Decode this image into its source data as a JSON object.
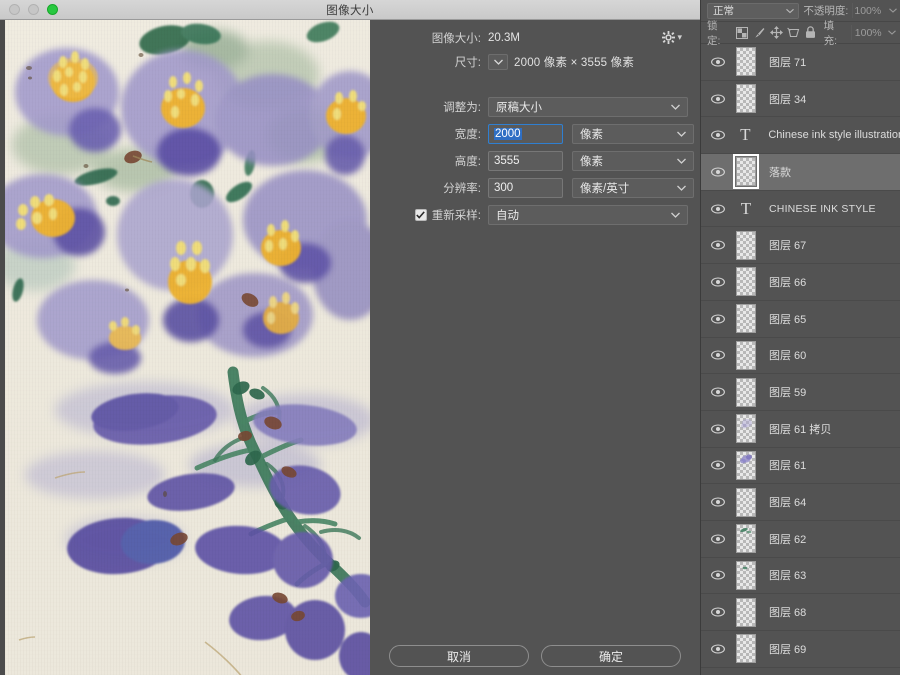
{
  "window": {
    "title": "图像大小",
    "traffic_lights": [
      "close-gray",
      "minimize-gray",
      "zoom-green"
    ]
  },
  "dialog": {
    "image_size_label": "图像大小:",
    "image_size_value": "20.3M",
    "gear_icon": "gear-icon",
    "dimensions_label": "尺寸:",
    "dimensions_value": "2000 像素  ×  3555 像素",
    "fit_to_label": "调整为:",
    "fit_to_value": "原稿大小",
    "width_label": "宽度:",
    "width_value": "2000",
    "width_unit": "像素",
    "height_label": "高度:",
    "height_value": "3555",
    "height_unit": "像素",
    "resolution_label": "分辨率:",
    "resolution_value": "300",
    "resolution_unit": "像素/英寸",
    "resample_label": "重新采样:",
    "resample_value": "自动",
    "resample_checked": true,
    "link_icon": "chain-link-icon",
    "cancel_label": "取消",
    "ok_label": "确定",
    "accent_color": "#2f6fc4",
    "bg_color": "#535353"
  },
  "layers_panel": {
    "blend_mode": "正常",
    "opacity_label": "不透明度:",
    "opacity_value": "100%",
    "lock_label": "锁定:",
    "lock_icons": [
      "transparency-checker-icon",
      "brush-icon",
      "move-arrows-icon",
      "artboard-icon",
      "lock-icon"
    ],
    "fill_label": "填充:",
    "fill_value": "100%",
    "layers": [
      {
        "name": "图层 71",
        "type": "raster",
        "visible": true,
        "selected": false,
        "thumb": "empty"
      },
      {
        "name": "图层 34",
        "type": "raster",
        "visible": true,
        "selected": false,
        "thumb": "empty"
      },
      {
        "name": "Chinese ink style illustration",
        "type": "text",
        "visible": true,
        "selected": false,
        "thumb": "T"
      },
      {
        "name": "落款",
        "type": "raster",
        "visible": true,
        "selected": true,
        "thumb": "empty"
      },
      {
        "name": "CHINESE INK STYLE",
        "type": "text",
        "visible": true,
        "selected": false,
        "thumb": "T"
      },
      {
        "name": "图层 67",
        "type": "raster",
        "visible": true,
        "selected": false,
        "thumb": "empty"
      },
      {
        "name": "图层 66",
        "type": "raster",
        "visible": true,
        "selected": false,
        "thumb": "empty"
      },
      {
        "name": "图层 65",
        "type": "raster",
        "visible": true,
        "selected": false,
        "thumb": "empty"
      },
      {
        "name": "图层 60",
        "type": "raster",
        "visible": true,
        "selected": false,
        "thumb": "empty"
      },
      {
        "name": "图层 59",
        "type": "raster",
        "visible": true,
        "selected": false,
        "thumb": "empty"
      },
      {
        "name": "图层 61 拷贝",
        "type": "raster",
        "visible": true,
        "selected": false,
        "thumb": "flower-faint"
      },
      {
        "name": "图层 61",
        "type": "raster",
        "visible": true,
        "selected": false,
        "thumb": "flower"
      },
      {
        "name": "图层 64",
        "type": "raster",
        "visible": true,
        "selected": false,
        "thumb": "empty"
      },
      {
        "name": "图层 62",
        "type": "raster",
        "visible": true,
        "selected": false,
        "thumb": "leaf"
      },
      {
        "name": "图层 63",
        "type": "raster",
        "visible": true,
        "selected": false,
        "thumb": "leaf-small"
      },
      {
        "name": "图层 68",
        "type": "raster",
        "visible": true,
        "selected": false,
        "thumb": "empty"
      },
      {
        "name": "图层 69",
        "type": "raster",
        "visible": true,
        "selected": false,
        "thumb": "empty"
      }
    ]
  },
  "artwork": {
    "description": "watercolor-flowers",
    "palette": {
      "paper": "#f3f0e8",
      "violet_light": "#a9a4d8",
      "violet_mid": "#8a83c8",
      "violet_deep": "#5b4fa8",
      "blue_deep": "#4a4fae",
      "yellow": "#f6b933",
      "yellow_light": "#f7e06b",
      "green_sage": "#a9bda4",
      "green_deep": "#2f6b51",
      "brown": "#7b4a36"
    }
  }
}
